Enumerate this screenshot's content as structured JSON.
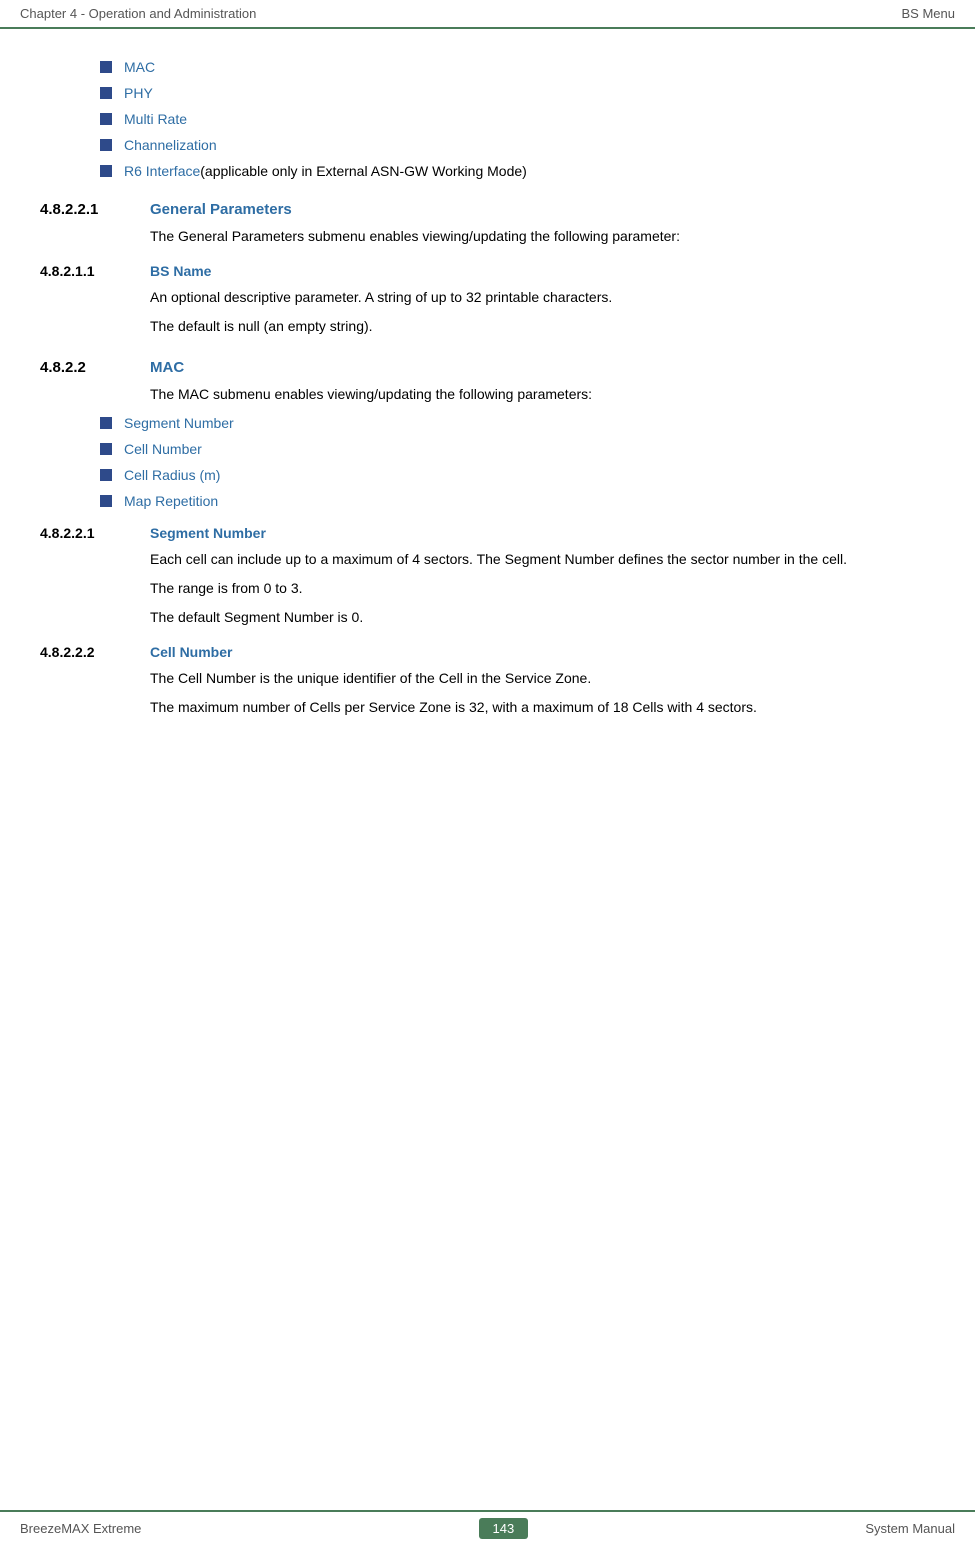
{
  "header": {
    "left": "Chapter 4 - Operation and Administration",
    "right": "BS Menu"
  },
  "footer": {
    "left": "BreezeMAX Extreme",
    "center": "143",
    "right": "System Manual"
  },
  "top_bullets": [
    {
      "id": "mac",
      "text": "MAC",
      "is_link": true
    },
    {
      "id": "phy",
      "text": "PHY",
      "is_link": true
    },
    {
      "id": "multi_rate",
      "text": "Multi Rate",
      "is_link": true
    },
    {
      "id": "channelization",
      "text": "Channelization",
      "is_link": true
    },
    {
      "id": "r6_interface",
      "text": "R6 Interface",
      "suffix": " (applicable only in External ASN-GW Working Mode)",
      "is_link": true
    }
  ],
  "sections": [
    {
      "id": "s4821",
      "num": "4.8.2.2.1",
      "title": "General Parameters",
      "paragraphs": [
        "The General Parameters submenu enables viewing/updating the following parameter:"
      ],
      "subsections": [
        {
          "id": "s48211",
          "num": "4.8.2.1.1",
          "title": "BS Name",
          "paragraphs": [
            "An optional descriptive parameter. A string of up to 32 printable characters.",
            "The default is null (an empty string)."
          ]
        }
      ]
    },
    {
      "id": "s4822",
      "num": "4.8.2.2",
      "title": "MAC",
      "paragraphs": [
        "The MAC submenu enables viewing/updating the following parameters:"
      ],
      "bullets": [
        {
          "text": "Segment Number",
          "is_link": true
        },
        {
          "text": "Cell Number",
          "is_link": true
        },
        {
          "text": "Cell Radius (m)",
          "is_link": true
        },
        {
          "text": "Map Repetition",
          "is_link": true
        }
      ],
      "subsections": [
        {
          "id": "s48221",
          "num": "4.8.2.2.1",
          "title": "Segment Number",
          "paragraphs": [
            "Each cell can include up to a maximum of 4 sectors. The Segment Number defines the sector number in the cell.",
            "The range is from 0 to 3.",
            "The default Segment Number is 0."
          ]
        },
        {
          "id": "s48222",
          "num": "4.8.2.2.2",
          "title": "Cell Number",
          "paragraphs": [
            "The Cell Number is the unique identifier of the Cell in the Service Zone.",
            "The maximum number of Cells per Service Zone is 32, with a maximum of 18 Cells with 4 sectors."
          ]
        }
      ]
    }
  ]
}
